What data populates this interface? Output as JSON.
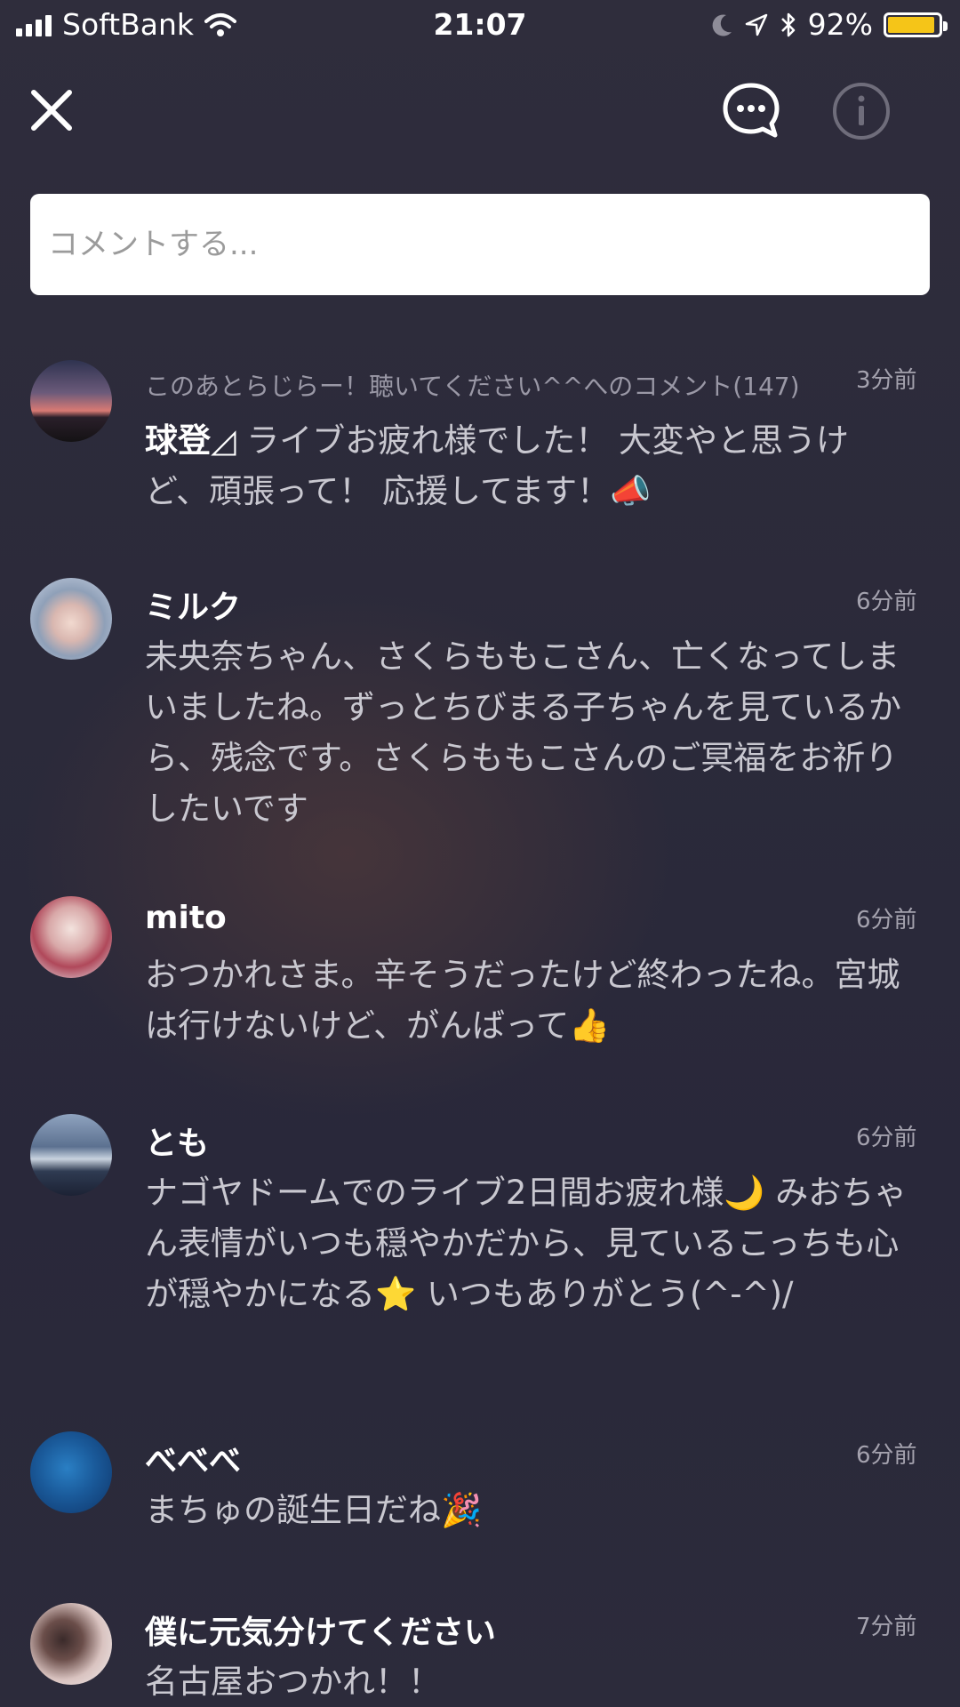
{
  "status_bar": {
    "carrier": "SoftBank",
    "time": "21:07",
    "battery_percent": "92%",
    "battery_level": 0.92,
    "battery_color": "#f5c518"
  },
  "top_bar": {
    "close_icon": "close-icon",
    "chat_icon": "chat-bubble-ellipsis-icon",
    "info_icon": "info-icon"
  },
  "comment_input": {
    "placeholder": "コメントする..."
  },
  "comments": [
    {
      "reference": "このあとらじらー！聴いてください^^へのコメント(147)",
      "time": "3分前",
      "author": "球登◿",
      "text": "ライブお疲れ様でした！ 大変やと思うけど、頑張って！ 応援してます！📣"
    },
    {
      "author": "ミルク",
      "time": "6分前",
      "text": "未央奈ちゃん、さくらももこさん、亡くなってしまいましたね。ずっとちびまる子ちゃんを見ているから、残念です。さくらももこさんのご冥福をお祈りしたいです"
    },
    {
      "author": "mito",
      "time": "6分前",
      "text": "おつかれさま。辛そうだったけど終わったね。宮城は行けないけど、がんばって👍"
    },
    {
      "author": "とも",
      "time": "6分前",
      "text": "ナゴヤドームでのライブ2日間お疲れ様🌙 みおちゃん表情がいつも穏やかだから、見ているこっちも心が穏やかになる⭐ いつもありがとう(^-^)/"
    },
    {
      "author": "べべべ",
      "time": "6分前",
      "text": "まちゅの誕生日だね🎉"
    },
    {
      "author": "僕に元気分けてください",
      "time": "7分前",
      "text": "名古屋おつかれ！！"
    }
  ]
}
